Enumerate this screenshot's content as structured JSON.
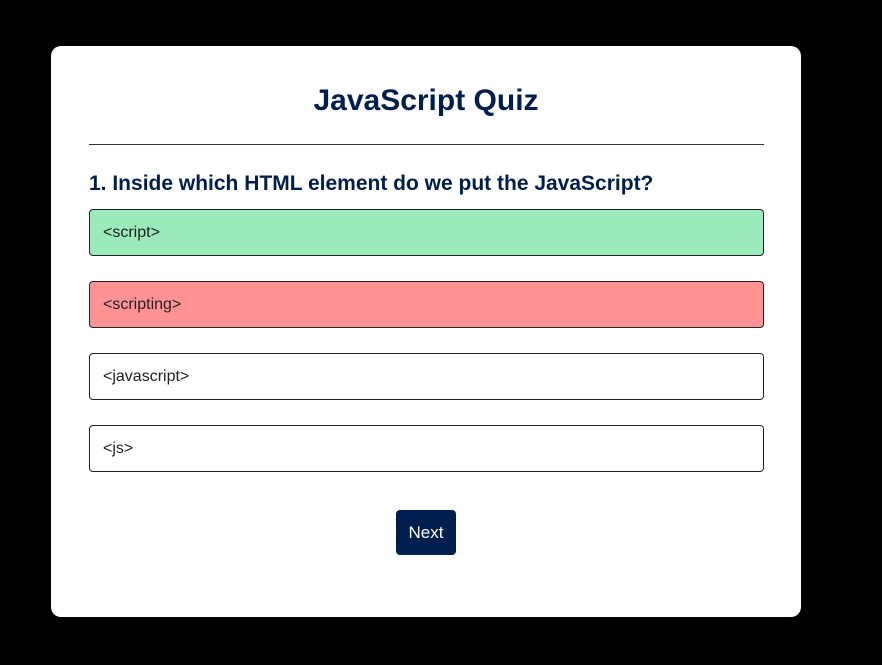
{
  "quiz": {
    "title": "JavaScript Quiz",
    "question": "1. Inside which HTML element do we put the JavaScript?",
    "answers": [
      {
        "label": "<script>",
        "state": "correct"
      },
      {
        "label": "<scripting>",
        "state": "incorrect"
      },
      {
        "label": "<javascript>",
        "state": "default"
      },
      {
        "label": "<js>",
        "state": "default"
      }
    ],
    "next_label": "Next"
  },
  "colors": {
    "page_background": "#000000",
    "card_background": "#ffffff",
    "heading": "#001e4d",
    "correct": "#9aeabc",
    "incorrect": "#ff9393",
    "next_button": "#001e4d"
  }
}
